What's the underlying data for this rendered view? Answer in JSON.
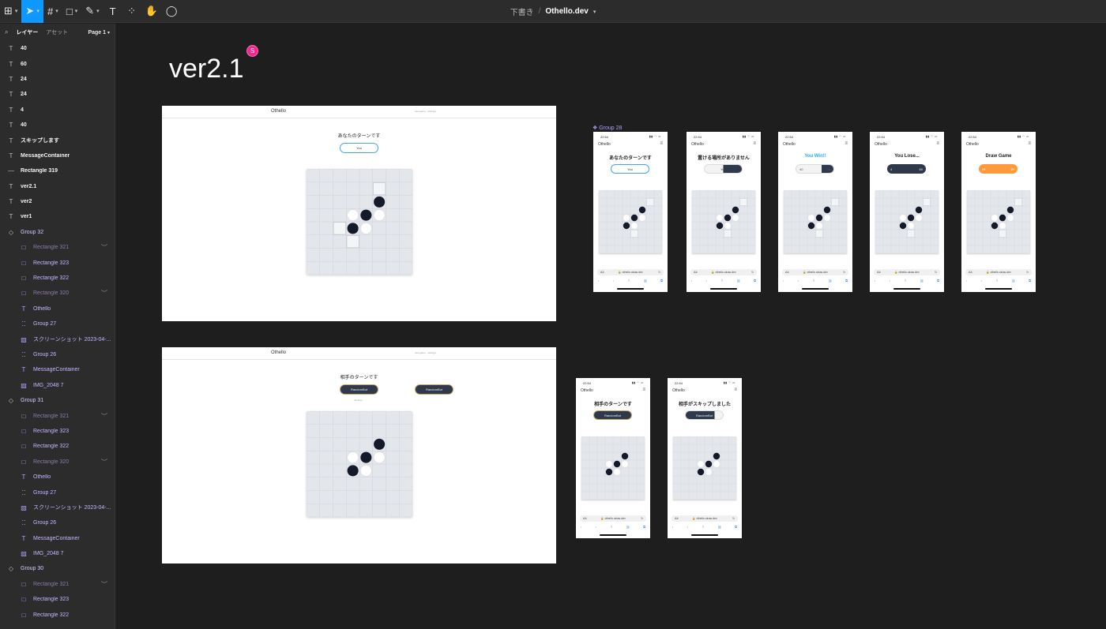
{
  "toolbar": {
    "tools": [
      {
        "name": "main-menu",
        "glyph": "⊞"
      },
      {
        "name": "move-tool",
        "glyph": "➤"
      },
      {
        "name": "frame-tool",
        "glyph": "#"
      },
      {
        "name": "shape-tool",
        "glyph": "□"
      },
      {
        "name": "pen-tool",
        "glyph": "✎"
      },
      {
        "name": "text-tool",
        "glyph": "T"
      },
      {
        "name": "components-tool",
        "glyph": "⁘"
      },
      {
        "name": "hand-tool",
        "glyph": "✋"
      },
      {
        "name": "comment-tool",
        "glyph": "◯"
      }
    ],
    "breadcrumb_project": "下書き",
    "breadcrumb_sep": "/",
    "file_name": "Othello.dev"
  },
  "sidebar": {
    "tab_layers": "レイヤー",
    "tab_assets": "アセット",
    "page": "Page 1",
    "layers": [
      {
        "icon": "T",
        "label": "40",
        "kind": "top"
      },
      {
        "icon": "T",
        "label": "60",
        "kind": "top"
      },
      {
        "icon": "T",
        "label": "24",
        "kind": "top"
      },
      {
        "icon": "T",
        "label": "24",
        "kind": "top"
      },
      {
        "icon": "T",
        "label": "4",
        "kind": "top"
      },
      {
        "icon": "T",
        "label": "40",
        "kind": "top"
      },
      {
        "icon": "T",
        "label": "スキップします",
        "kind": "top"
      },
      {
        "icon": "T",
        "label": "MessageContainer",
        "kind": "top"
      },
      {
        "icon": "—",
        "label": "Rectangle 319",
        "kind": "top"
      },
      {
        "icon": "T",
        "label": "ver2.1",
        "kind": "top"
      },
      {
        "icon": "T",
        "label": "ver2",
        "kind": "top"
      },
      {
        "icon": "T",
        "label": "ver1",
        "kind": "top"
      },
      {
        "icon": "◇",
        "label": "Group 32",
        "kind": "grp-head"
      },
      {
        "icon": "□",
        "label": "Rectangle 321",
        "kind": "hid",
        "eye": true,
        "indent": true
      },
      {
        "icon": "□",
        "label": "Rectangle 323",
        "kind": "grp",
        "indent": true
      },
      {
        "icon": "□",
        "label": "Rectangle 322",
        "kind": "grp",
        "indent": true
      },
      {
        "icon": "□",
        "label": "Rectangle 320",
        "kind": "hid",
        "eye": true,
        "indent": true
      },
      {
        "icon": "T",
        "label": "Othello",
        "kind": "grp",
        "indent": true
      },
      {
        "icon": "⁚⁚",
        "label": "Group 27",
        "kind": "grp",
        "indent": true
      },
      {
        "icon": "▨",
        "label": "スクリーンショット 2023-04-...",
        "kind": "grp",
        "indent": true
      },
      {
        "icon": "⁚⁚",
        "label": "Group 26",
        "kind": "grp",
        "indent": true
      },
      {
        "icon": "T",
        "label": "MessageContainer",
        "kind": "grp",
        "indent": true
      },
      {
        "icon": "▨",
        "label": "IMG_2048 7",
        "kind": "grp",
        "indent": true
      },
      {
        "icon": "◇",
        "label": "Group 31",
        "kind": "grp-head"
      },
      {
        "icon": "□",
        "label": "Rectangle 321",
        "kind": "hid",
        "eye": true,
        "indent": true
      },
      {
        "icon": "□",
        "label": "Rectangle 323",
        "kind": "grp",
        "indent": true
      },
      {
        "icon": "□",
        "label": "Rectangle 322",
        "kind": "grp",
        "indent": true
      },
      {
        "icon": "□",
        "label": "Rectangle 320",
        "kind": "hid",
        "eye": true,
        "indent": true
      },
      {
        "icon": "T",
        "label": "Othello",
        "kind": "grp",
        "indent": true
      },
      {
        "icon": "⁚⁚",
        "label": "Group 27",
        "kind": "grp",
        "indent": true
      },
      {
        "icon": "▨",
        "label": "スクリーンショット 2023-04-...",
        "kind": "grp",
        "indent": true
      },
      {
        "icon": "⁚⁚",
        "label": "Group 26",
        "kind": "grp",
        "indent": true
      },
      {
        "icon": "T",
        "label": "MessageContainer",
        "kind": "grp",
        "indent": true
      },
      {
        "icon": "▨",
        "label": "IMG_2048 7",
        "kind": "grp",
        "indent": true
      },
      {
        "icon": "◇",
        "label": "Group 30",
        "kind": "grp-head"
      },
      {
        "icon": "□",
        "label": "Rectangle 321",
        "kind": "hid",
        "eye": true,
        "indent": true
      },
      {
        "icon": "□",
        "label": "Rectangle 323",
        "kind": "grp",
        "indent": true
      },
      {
        "icon": "□",
        "label": "Rectangle 322",
        "kind": "grp",
        "indent": true
      }
    ]
  },
  "canvas": {
    "title": "ver2.1",
    "avatar_initial": "S",
    "group_label": "❖ Group 28",
    "desktop_top": {
      "logo": "Othello",
      "links": "new game · settings",
      "message": "あなたのターンです",
      "button": "You"
    },
    "desktop_bottom": {
      "logo": "Othello",
      "links": "new game · settings",
      "message": "相手のターンです",
      "button1": "RandomBot",
      "button2": "RandomBot",
      "note": "thinking..."
    },
    "phones": [
      {
        "time": "22:54",
        "app": "Othello",
        "message": "あなたのターンです",
        "button": "You",
        "url": "othello.oinas.dev"
      },
      {
        "time": "22:54",
        "app": "Othello",
        "message": "置ける場所がありません",
        "button": "You",
        "url": "othello.oinas.dev"
      },
      {
        "time": "22:54",
        "app": "Othello",
        "message": "You Win!!",
        "button_left": "40",
        "button_right": "24",
        "url": "othello.oinas.dev"
      },
      {
        "time": "22:54",
        "app": "Othello",
        "message": "You Lose...",
        "button_left": "4",
        "button_right": "60",
        "url": "othello.oinas.dev"
      },
      {
        "time": "22:54",
        "app": "Othello",
        "message": "Draw Game",
        "button_left": "24",
        "button_right": "40",
        "url": "othello.oinas.dev"
      },
      {
        "time": "22:54",
        "app": "Othello",
        "message": "相手のターンです",
        "button": "RandomBot",
        "url": "othello.oinas.dev"
      },
      {
        "time": "22:54",
        "app": "Othello",
        "message": "相手がスキップしました",
        "button": "RandomBot",
        "url": "othello.oinas.dev"
      }
    ]
  }
}
